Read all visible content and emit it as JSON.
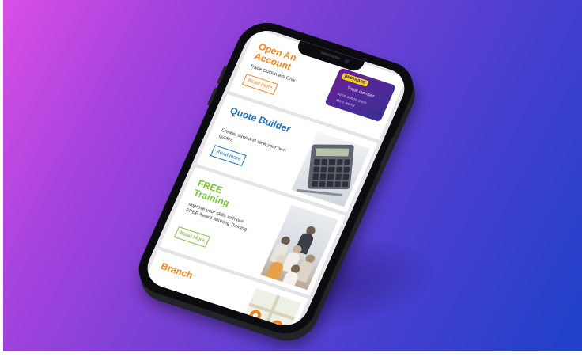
{
  "cards": [
    {
      "title": "Open An Account",
      "description": "Trade Customers Only",
      "button_label": "Read more",
      "accent": "#f2841e",
      "image": {
        "type": "trade-card",
        "logo_text": "BESTRADE",
        "member_label": "Trade member",
        "card_number": "0000 00000 0000",
        "card_name": "MR J. SMITH"
      }
    },
    {
      "title": "Quote Builder",
      "description": "Create, save and view your own quotes",
      "button_label": "Read more",
      "accent": "#1f6fb8",
      "image": {
        "type": "calculator-photo"
      }
    },
    {
      "title": "FREE Training",
      "description": "Improve your skills with our FREE Award Winning Training",
      "button_label": "Read More",
      "accent": "#7cc23a",
      "image": {
        "type": "training-room-photo"
      }
    },
    {
      "title": "Branch",
      "accent": "#f2841e",
      "image": {
        "type": "map-thumbnail"
      }
    }
  ],
  "background": {
    "gradient_start": "#d94fe6",
    "gradient_end": "#1d41c7"
  },
  "phone_color": "#0c0c10"
}
